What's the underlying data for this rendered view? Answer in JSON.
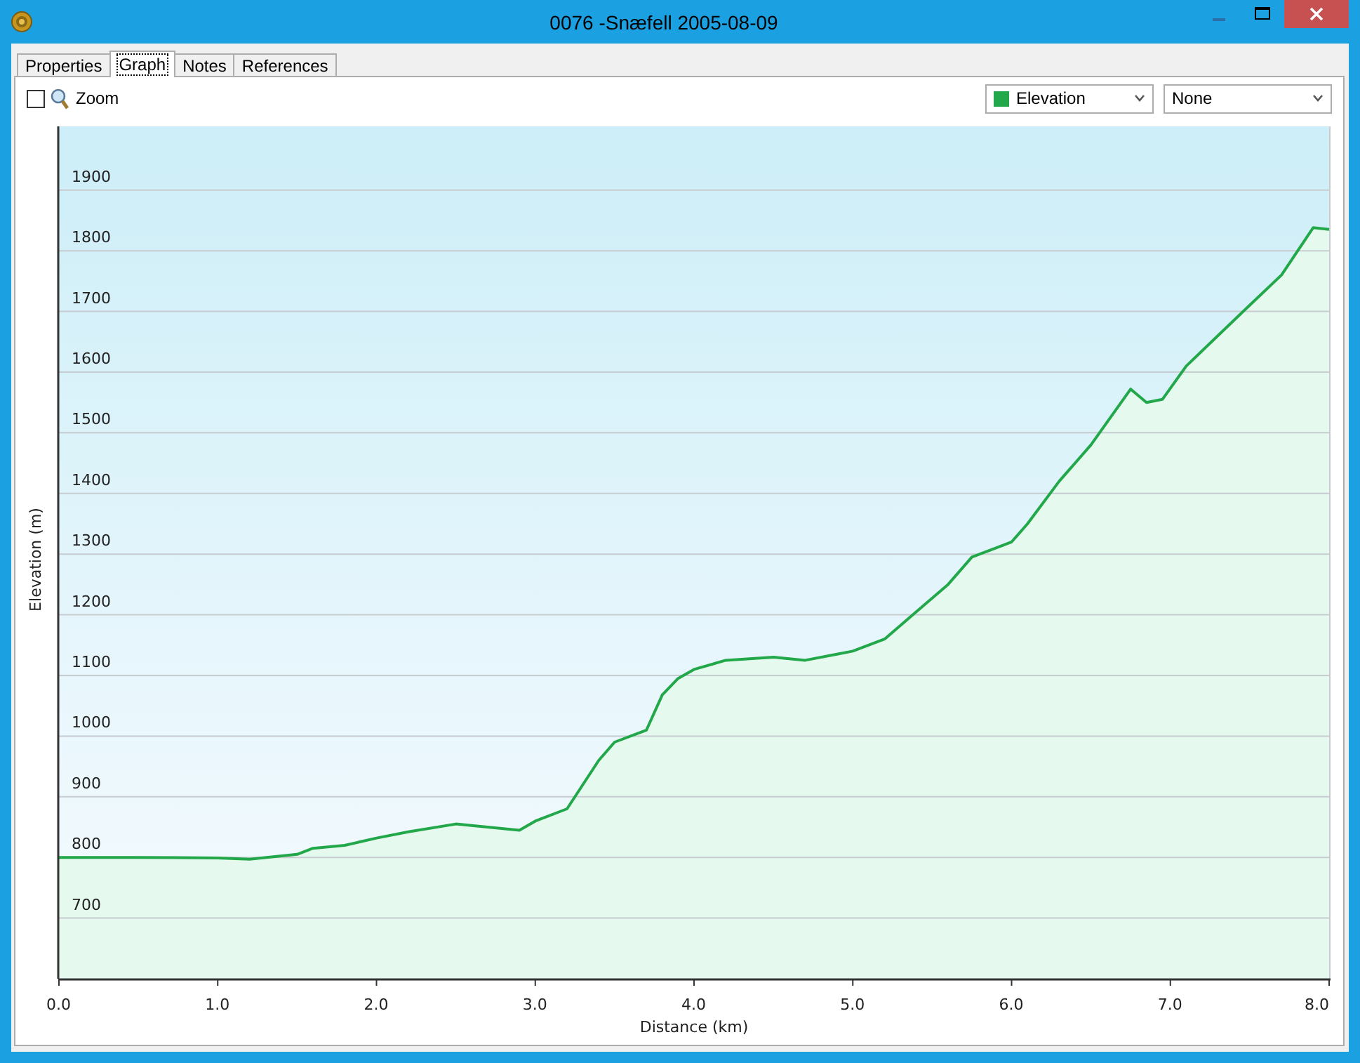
{
  "window": {
    "title": "0076 -Snæfell 2005-08-09"
  },
  "tabs": [
    {
      "label": "Properties",
      "selected": false
    },
    {
      "label": "Graph",
      "selected": true
    },
    {
      "label": "Notes",
      "selected": false
    },
    {
      "label": "References",
      "selected": false
    }
  ],
  "toolbar": {
    "zoom": {
      "label": "Zoom",
      "checked": false
    },
    "compare_select": {
      "value": "None"
    }
  },
  "graph": {
    "chart_data": {
      "type": "area",
      "grid": true,
      "xlabel": "Distance  (km)",
      "ylabel": "Elevation (m)",
      "x": [
        0,
        0.5,
        1,
        1.2,
        1.5,
        1.6,
        1.8,
        2,
        2.2,
        2.5,
        2.7,
        2.9,
        3,
        3.2,
        3.4,
        3.5,
        3.7,
        3.8,
        3.9,
        4,
        4.2,
        4.5,
        4.7,
        4.9,
        5,
        5.2,
        5.4,
        5.6,
        5.75,
        5.9,
        6,
        6.1,
        6.3,
        6.5,
        6.75,
        6.85,
        6.95,
        7.1,
        7.3,
        7.5,
        7.7,
        7.9,
        8
      ],
      "series": [
        {
          "name": "Elevation",
          "color": "#22a84a",
          "values": [
            800,
            800,
            799,
            797,
            805,
            815,
            820,
            832,
            842,
            855,
            850,
            845,
            860,
            880,
            960,
            990,
            1010,
            1068,
            1095,
            1110,
            1125,
            1130,
            1125,
            1135,
            1140,
            1160,
            1205,
            1250,
            1295,
            1310,
            1320,
            1350,
            1420,
            1480,
            1572,
            1550,
            1555,
            1610,
            1660,
            1710,
            1760,
            1838,
            1835
          ]
        }
      ],
      "xlim": [
        0,
        8
      ],
      "ylim": [
        600,
        2005
      ],
      "xticks": [
        {
          "value": 0,
          "label": "0.0"
        },
        {
          "value": 1,
          "label": "1.0"
        },
        {
          "value": 2,
          "label": "2.0"
        },
        {
          "value": 3,
          "label": "3.0"
        },
        {
          "value": 4,
          "label": "4.0"
        },
        {
          "value": 5,
          "label": "5.0"
        },
        {
          "value": 6,
          "label": "6.0"
        },
        {
          "value": 7,
          "label": "7.0"
        },
        {
          "value": 8,
          "label": "8.0"
        }
      ],
      "yticks": [
        700,
        800,
        900,
        1000,
        1100,
        1200,
        1300,
        1400,
        1500,
        1600,
        1700,
        1800,
        1900
      ]
    }
  }
}
